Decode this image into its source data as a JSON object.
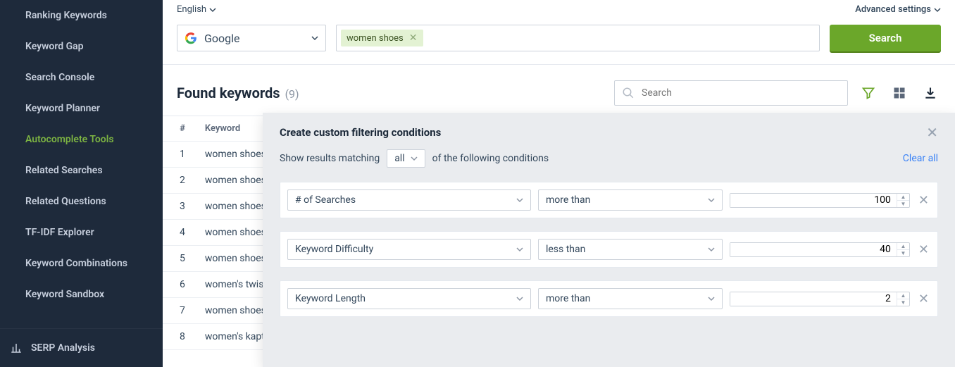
{
  "sidebar": {
    "items": [
      {
        "label": "Ranking Keywords"
      },
      {
        "label": "Keyword Gap"
      },
      {
        "label": "Search Console"
      },
      {
        "label": "Keyword Planner"
      },
      {
        "label": "Autocomplete Tools",
        "active": true
      },
      {
        "label": "Related Searches"
      },
      {
        "label": "Related Questions"
      },
      {
        "label": "TF-IDF Explorer"
      },
      {
        "label": "Keyword Combinations"
      },
      {
        "label": "Keyword Sandbox"
      }
    ],
    "serp_analysis": "SERP Analysis"
  },
  "topbar": {
    "language": "English",
    "advanced": "Advanced settings"
  },
  "search": {
    "engine": "Google",
    "keyword_tag": "women shoes",
    "search_btn": "Search"
  },
  "found": {
    "title": "Found keywords",
    "count": "(9)",
    "search_placeholder": "Search"
  },
  "table": {
    "headers": {
      "num": "#",
      "keyword": "Keyword"
    },
    "rows": [
      {
        "num": "1",
        "keyword": "women shoes"
      },
      {
        "num": "2",
        "keyword": "women shoes"
      },
      {
        "num": "3",
        "keyword": "women shoes"
      },
      {
        "num": "4",
        "keyword": "women shoes"
      },
      {
        "num": "5",
        "keyword": "women shoes"
      },
      {
        "num": "6",
        "keyword": "women's twis"
      },
      {
        "num": "7",
        "keyword": "women shoes"
      },
      {
        "num": "8",
        "keyword": "women's kapt"
      }
    ]
  },
  "filter_panel": {
    "title": "Create custom filtering conditions",
    "match_prefix": "Show results matching",
    "match_mode": "all",
    "match_suffix": "of the following conditions",
    "clear_all": "Clear all",
    "conditions": [
      {
        "field": "# of Searches",
        "op": "more than",
        "value": "100"
      },
      {
        "field": "Keyword Difficulty",
        "op": "less than",
        "value": "40"
      },
      {
        "field": "Keyword Length",
        "op": "more than",
        "value": "2"
      }
    ]
  }
}
